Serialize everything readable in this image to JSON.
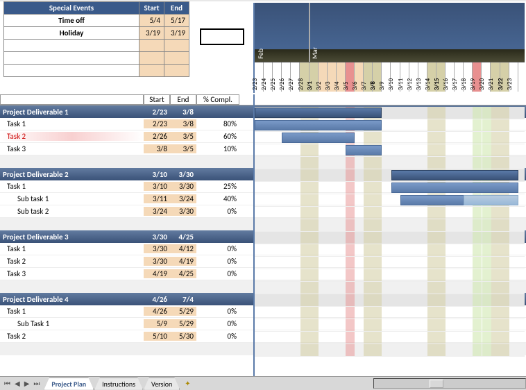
{
  "special_events": {
    "title": "Special Events",
    "headers": {
      "start": "Start",
      "end": "End"
    },
    "rows": [
      {
        "name": "Time off",
        "start": "5/4",
        "end": "5/17"
      },
      {
        "name": "Holiday",
        "start": "3/19",
        "end": "3/19"
      },
      {
        "name": "",
        "start": "",
        "end": ""
      },
      {
        "name": "",
        "start": "",
        "end": ""
      },
      {
        "name": "",
        "start": "",
        "end": ""
      }
    ]
  },
  "task_headers": {
    "start": "Start",
    "end": "End",
    "compl": "% Compl."
  },
  "months": {
    "feb": "Feb",
    "mar": "Mar"
  },
  "dates": [
    "2/23",
    "2/24",
    "2/25",
    "2/26",
    "2/27",
    "2/28",
    "3/1",
    "3/2",
    "3/3",
    "3/4",
    "3/5",
    "3/6",
    "3/7",
    "3/8",
    "3/9",
    "3/10",
    "3/11",
    "3/12",
    "3/13",
    "3/14",
    "3/15",
    "3/16",
    "3/17",
    "3/18",
    "3/19",
    "3/20",
    "3/21",
    "3/22",
    "3/23"
  ],
  "deliverables": [
    {
      "name": "Project Deliverable 1",
      "start": "2/23",
      "end": "3/8",
      "tasks": [
        {
          "name": "Task 1",
          "start": "2/23",
          "end": "3/8",
          "compl": "80%"
        },
        {
          "name": "Task 2",
          "start": "2/26",
          "end": "3/5",
          "compl": "60%",
          "warn": true
        },
        {
          "name": "Task 3",
          "start": "3/8",
          "end": "3/5",
          "compl": "10%"
        }
      ]
    },
    {
      "name": "Project Deliverable 2",
      "start": "3/10",
      "end": "3/30",
      "tasks": [
        {
          "name": "Task 1",
          "start": "3/10",
          "end": "3/30",
          "compl": "25%"
        },
        {
          "name": "Sub task 1",
          "start": "3/11",
          "end": "3/24",
          "compl": "40%",
          "sub": true
        },
        {
          "name": "Sub task 2",
          "start": "3/24",
          "end": "3/30",
          "compl": "0%",
          "sub": true
        }
      ]
    },
    {
      "name": "Project Deliverable 3",
      "start": "3/30",
      "end": "4/25",
      "tasks": [
        {
          "name": "Task 1",
          "start": "3/30",
          "end": "4/12",
          "compl": "0%"
        },
        {
          "name": "Task 2",
          "start": "3/30",
          "end": "4/19",
          "compl": "0%"
        },
        {
          "name": "Task 3",
          "start": "4/19",
          "end": "4/25",
          "compl": "0%"
        }
      ]
    },
    {
      "name": "Project Deliverable 4",
      "start": "4/26",
      "end": "7/4",
      "tasks": [
        {
          "name": "Task 1",
          "start": "4/26",
          "end": "5/29",
          "compl": "0%"
        },
        {
          "name": "Sub Task 1",
          "start": "5/9",
          "end": "5/29",
          "compl": "0%",
          "sub": true
        },
        {
          "name": "Task 2",
          "start": "5/10",
          "end": "5/30",
          "compl": "0%"
        }
      ]
    }
  ],
  "chart_data": {
    "type": "gantt",
    "date_range": [
      "2/23",
      "3/23"
    ],
    "highlight_cols": {
      "weekend_tan": [
        "2/28",
        "3/1",
        "3/7",
        "3/8",
        "3/14",
        "3/15",
        "3/21",
        "3/22"
      ],
      "holiday": [
        "3/19"
      ],
      "bold": [
        "3/1",
        "3/8",
        "3/15",
        "3/22"
      ]
    },
    "bars": [
      {
        "group": 0,
        "kind": "deliverable",
        "from": "2/23",
        "to": "3/8"
      },
      {
        "group": 0,
        "kind": "task",
        "from": "2/23",
        "to": "3/8"
      },
      {
        "group": 0,
        "kind": "task",
        "from": "2/26",
        "to": "3/5"
      },
      {
        "group": 0,
        "kind": "task",
        "from": "3/5",
        "to": "3/8"
      },
      {
        "group": 1,
        "kind": "deliverable",
        "from": "3/10",
        "to": "3/23"
      },
      {
        "group": 1,
        "kind": "task",
        "from": "3/10",
        "to": "3/23"
      },
      {
        "group": 1,
        "kind": "task",
        "from": "3/11",
        "to": "3/23"
      },
      {
        "group": 1,
        "kind": "light",
        "from": "3/18",
        "to": "3/23"
      }
    ]
  },
  "sheet_tabs": {
    "active": "Project Plan",
    "others": [
      "Instructions",
      "Version"
    ]
  }
}
